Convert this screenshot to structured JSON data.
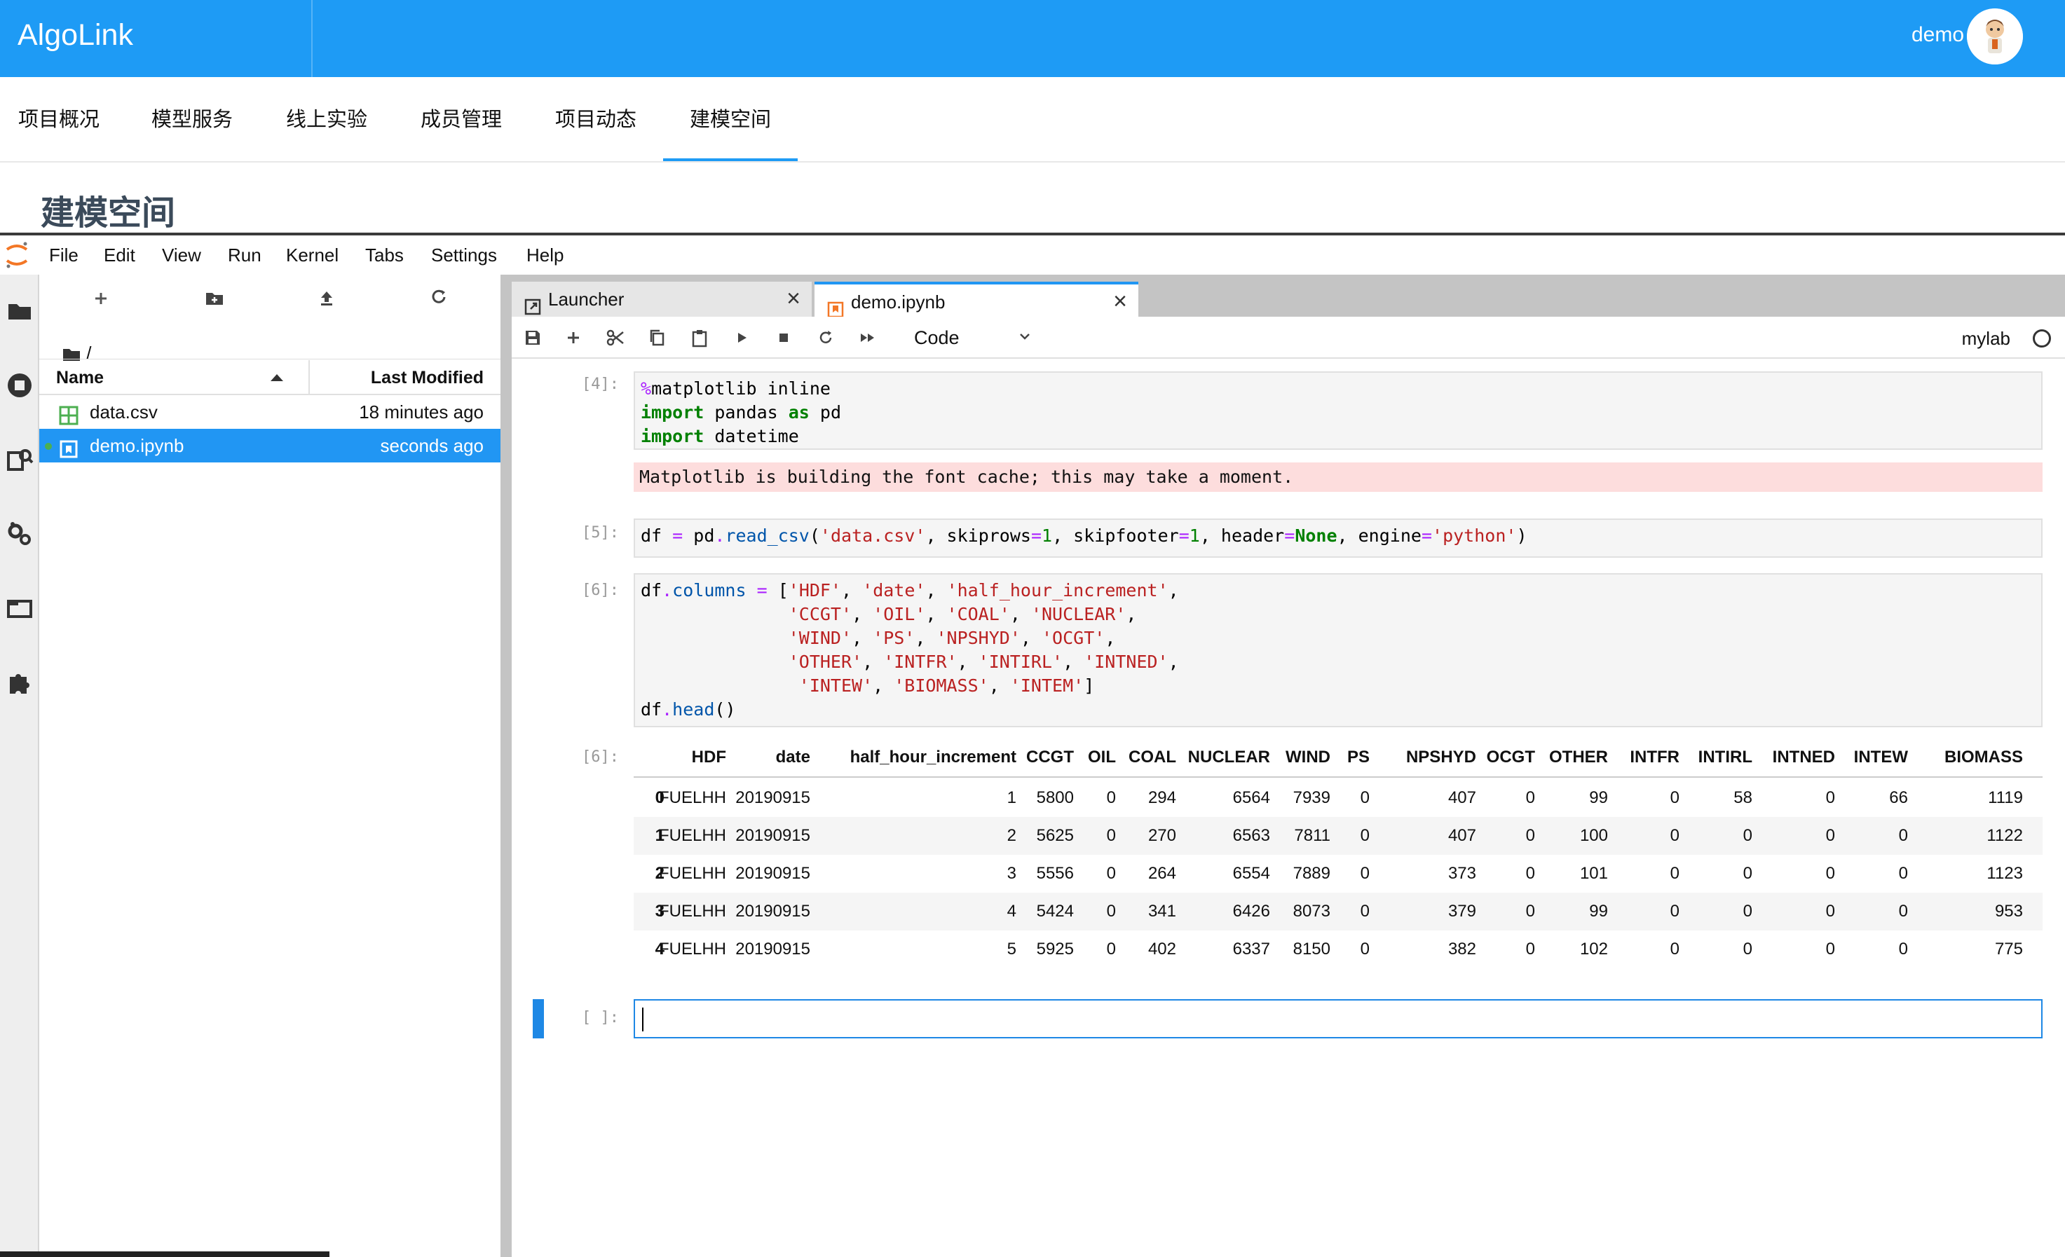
{
  "header": {
    "brand": "AlgoLink",
    "user": "demo"
  },
  "nav": {
    "items": [
      "项目概况",
      "模型服务",
      "线上实验",
      "成员管理",
      "项目动态",
      "建模空间"
    ],
    "active": "建模空间"
  },
  "page_title": "建模空间",
  "menubar": [
    "File",
    "Edit",
    "View",
    "Run",
    "Kernel",
    "Tabs",
    "Settings",
    "Help"
  ],
  "sidebar_icons": [
    "folder-icon",
    "running-icon",
    "commands-icon",
    "property-inspector-icon",
    "tabs-icon",
    "extension-icon"
  ],
  "filebrowser": {
    "toolbar": [
      "new-launcher-icon",
      "new-folder-icon",
      "upload-icon",
      "refresh-icon"
    ],
    "breadcrumb": "/",
    "columns": {
      "name": "Name",
      "modified": "Last Modified"
    },
    "files": [
      {
        "name": "data.csv",
        "modified": "18 minutes ago",
        "icon": "spreadsheet-icon",
        "selected": false
      },
      {
        "name": "demo.ipynb",
        "modified": "seconds ago",
        "icon": "notebook-icon",
        "selected": true
      }
    ]
  },
  "tabs": [
    {
      "label": "Launcher",
      "icon": "launcher-icon"
    },
    {
      "label": "demo.ipynb",
      "icon": "notebook-icon",
      "active": true
    }
  ],
  "nb_toolbar": {
    "cell_type": "Code",
    "kernel": "mylab"
  },
  "cells": {
    "c4_prompt": "[4]:",
    "c5_prompt": "[5]:",
    "c6_prompt": "[6]:",
    "c6_out_prompt": "[6]:",
    "empty_prompt": "[ ]:",
    "stderr": "Matplotlib is building the font cache; this may take a moment."
  },
  "dataframe": {
    "columns": [
      "",
      "HDF",
      "date",
      "half_hour_increment",
      "CCGT",
      "OIL",
      "COAL",
      "NUCLEAR",
      "WIND",
      "PS",
      "NPSHYD",
      "OCGT",
      "OTHER",
      "INTFR",
      "INTIRL",
      "INTNED",
      "INTEW",
      "BIOMASS"
    ],
    "rows": [
      [
        "0",
        "FUELHH",
        "20190915",
        "1",
        "5800",
        "0",
        "294",
        "6564",
        "7939",
        "0",
        "407",
        "0",
        "99",
        "0",
        "58",
        "0",
        "66",
        "1119"
      ],
      [
        "1",
        "FUELHH",
        "20190915",
        "2",
        "5625",
        "0",
        "270",
        "6563",
        "7811",
        "0",
        "407",
        "0",
        "100",
        "0",
        "0",
        "0",
        "0",
        "1122"
      ],
      [
        "2",
        "FUELHH",
        "20190915",
        "3",
        "5556",
        "0",
        "264",
        "6554",
        "7889",
        "0",
        "373",
        "0",
        "101",
        "0",
        "0",
        "0",
        "0",
        "1123"
      ],
      [
        "3",
        "FUELHH",
        "20190915",
        "4",
        "5424",
        "0",
        "341",
        "6426",
        "8073",
        "0",
        "379",
        "0",
        "99",
        "0",
        "0",
        "0",
        "0",
        "953"
      ],
      [
        "4",
        "FUELHH",
        "20190915",
        "5",
        "5925",
        "0",
        "402",
        "6337",
        "8150",
        "0",
        "382",
        "0",
        "102",
        "0",
        "0",
        "0",
        "0",
        "775"
      ]
    ]
  },
  "colors": {
    "brand_blue": "#1e9bf5",
    "selection_blue": "#2196f3",
    "stderr_bg": "#fddddd"
  }
}
